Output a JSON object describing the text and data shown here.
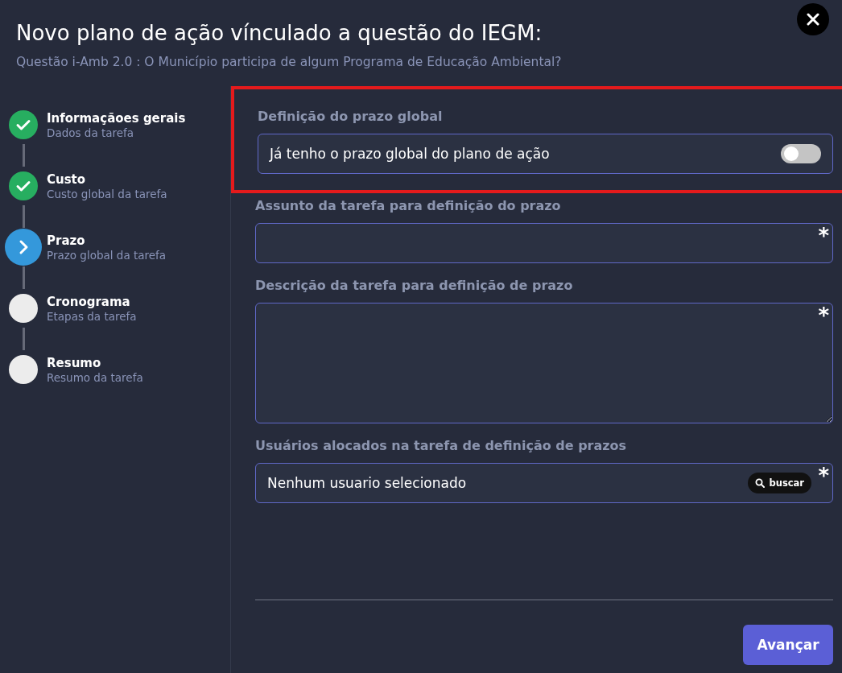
{
  "dialog": {
    "title": "Novo plano de ação vínculado a questão do IEGM:",
    "subtitle": "Questão i-Amb 2.0 : O Município participa de algum Programa de Educação Ambiental?"
  },
  "steps": [
    {
      "title": "Informaçãoes gerais",
      "description": "Dados da tarefa",
      "kind": "done"
    },
    {
      "title": "Custo",
      "description": "Custo global da tarefa",
      "kind": "done"
    },
    {
      "title": "Prazo",
      "description": "Prazo global da tarefa",
      "kind": "current"
    },
    {
      "title": "Cronograma",
      "description": "Etapas da tarefa",
      "kind": "pending"
    },
    {
      "title": "Resumo",
      "description": "Resumo da tarefa",
      "kind": "pending"
    }
  ],
  "deadline_section": {
    "label": "Definição do prazo global",
    "highlighted": true,
    "toggle": {
      "label": "Já tenho o prazo global do plano de ação",
      "on": false
    }
  },
  "fields": [
    {
      "kind": "input",
      "label": "Assunto da tarefa para definição do prazo",
      "required_mark": "*"
    },
    {
      "kind": "textarea",
      "label": "Descrição da tarefa para definição de prazo",
      "required_mark": "*"
    },
    {
      "kind": "picker",
      "label": "Usuários alocados na tarefa de definição de prazos",
      "value": "Nenhum usuario selecionado",
      "button": "buscar",
      "required_mark": "*"
    }
  ],
  "next_button": "Avançar"
}
